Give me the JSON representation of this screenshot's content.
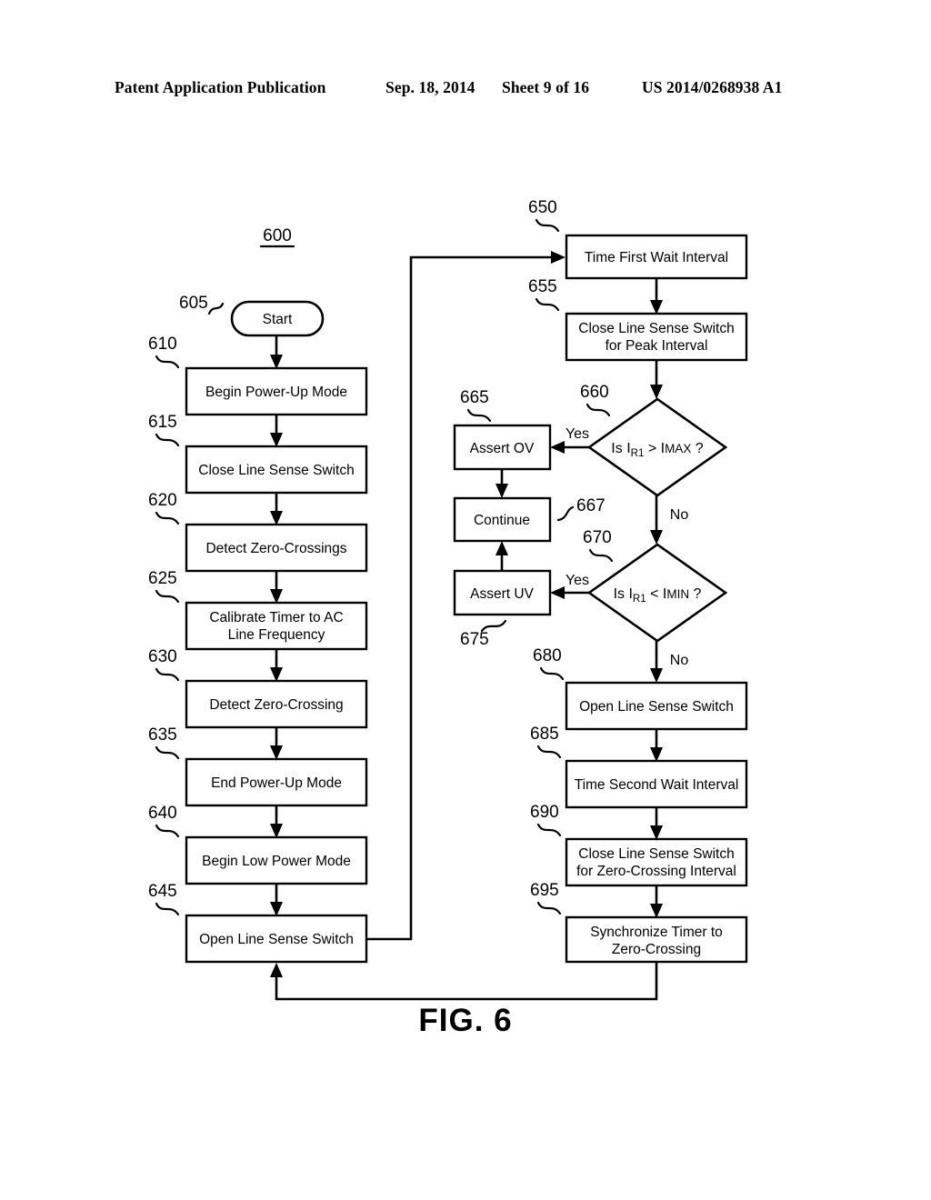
{
  "header": {
    "publication": "Patent Application Publication",
    "date": "Sep. 18, 2014",
    "sheet": "Sheet 9 of 16",
    "number": "US 2014/0268938 A1"
  },
  "figure": {
    "caption": "FIG. 6",
    "diagram_number": "600"
  },
  "nodes": {
    "n605": {
      "ref": "605",
      "label": "Start",
      "shape": "terminator"
    },
    "n610": {
      "ref": "610",
      "label": "Begin Power-Up Mode",
      "shape": "process"
    },
    "n615": {
      "ref": "615",
      "label": "Close Line Sense Switch",
      "shape": "process"
    },
    "n620": {
      "ref": "620",
      "label": "Detect Zero-Crossings",
      "shape": "process"
    },
    "n625": {
      "ref": "625",
      "label_line1": "Calibrate Timer to AC",
      "label_line2": "Line Frequency",
      "shape": "process"
    },
    "n630": {
      "ref": "630",
      "label": "Detect Zero-Crossing",
      "shape": "process"
    },
    "n635": {
      "ref": "635",
      "label": "End Power-Up Mode",
      "shape": "process"
    },
    "n640": {
      "ref": "640",
      "label": "Begin Low Power Mode",
      "shape": "process"
    },
    "n645": {
      "ref": "645",
      "label": "Open Line Sense Switch",
      "shape": "process"
    },
    "n650": {
      "ref": "650",
      "label": "Time First Wait Interval",
      "shape": "process"
    },
    "n655": {
      "ref": "655",
      "label_line1": "Close Line Sense Switch",
      "label_line2": "for Peak Interval",
      "shape": "process"
    },
    "n660": {
      "ref": "660",
      "shape": "decision",
      "text_is": "Is",
      "var1_base": "I",
      "var1_sub": "R1",
      "operator": ">",
      "var2_base": "I",
      "var2_sub": "MAX",
      "question": "?"
    },
    "n665": {
      "ref": "665",
      "label": "Assert OV",
      "shape": "process"
    },
    "n667": {
      "ref": "667",
      "label": "Continue",
      "shape": "process"
    },
    "n670": {
      "ref": "670",
      "shape": "decision",
      "text_is": "Is",
      "var1_base": "I",
      "var1_sub": "R1",
      "operator": "<",
      "var2_base": "I",
      "var2_sub": "MIN",
      "question": "?"
    },
    "n675": {
      "ref": "675",
      "label": "Assert UV",
      "shape": "process"
    },
    "n680": {
      "ref": "680",
      "label": "Open Line Sense Switch",
      "shape": "process"
    },
    "n685": {
      "ref": "685",
      "label": "Time Second Wait Interval",
      "shape": "process"
    },
    "n690": {
      "ref": "690",
      "label_line1": "Close Line Sense Switch",
      "label_line2": "for Zero-Crossing Interval",
      "shape": "process"
    },
    "n695": {
      "ref": "695",
      "label_line1": "Synchronize Timer to",
      "label_line2": "Zero-Crossing",
      "shape": "process"
    }
  },
  "branch_labels": {
    "yes_660": "Yes",
    "no_660": "No",
    "yes_670": "Yes",
    "no_670": "No"
  },
  "colors": {
    "ink": "#000000",
    "paper": "#ffffff"
  }
}
